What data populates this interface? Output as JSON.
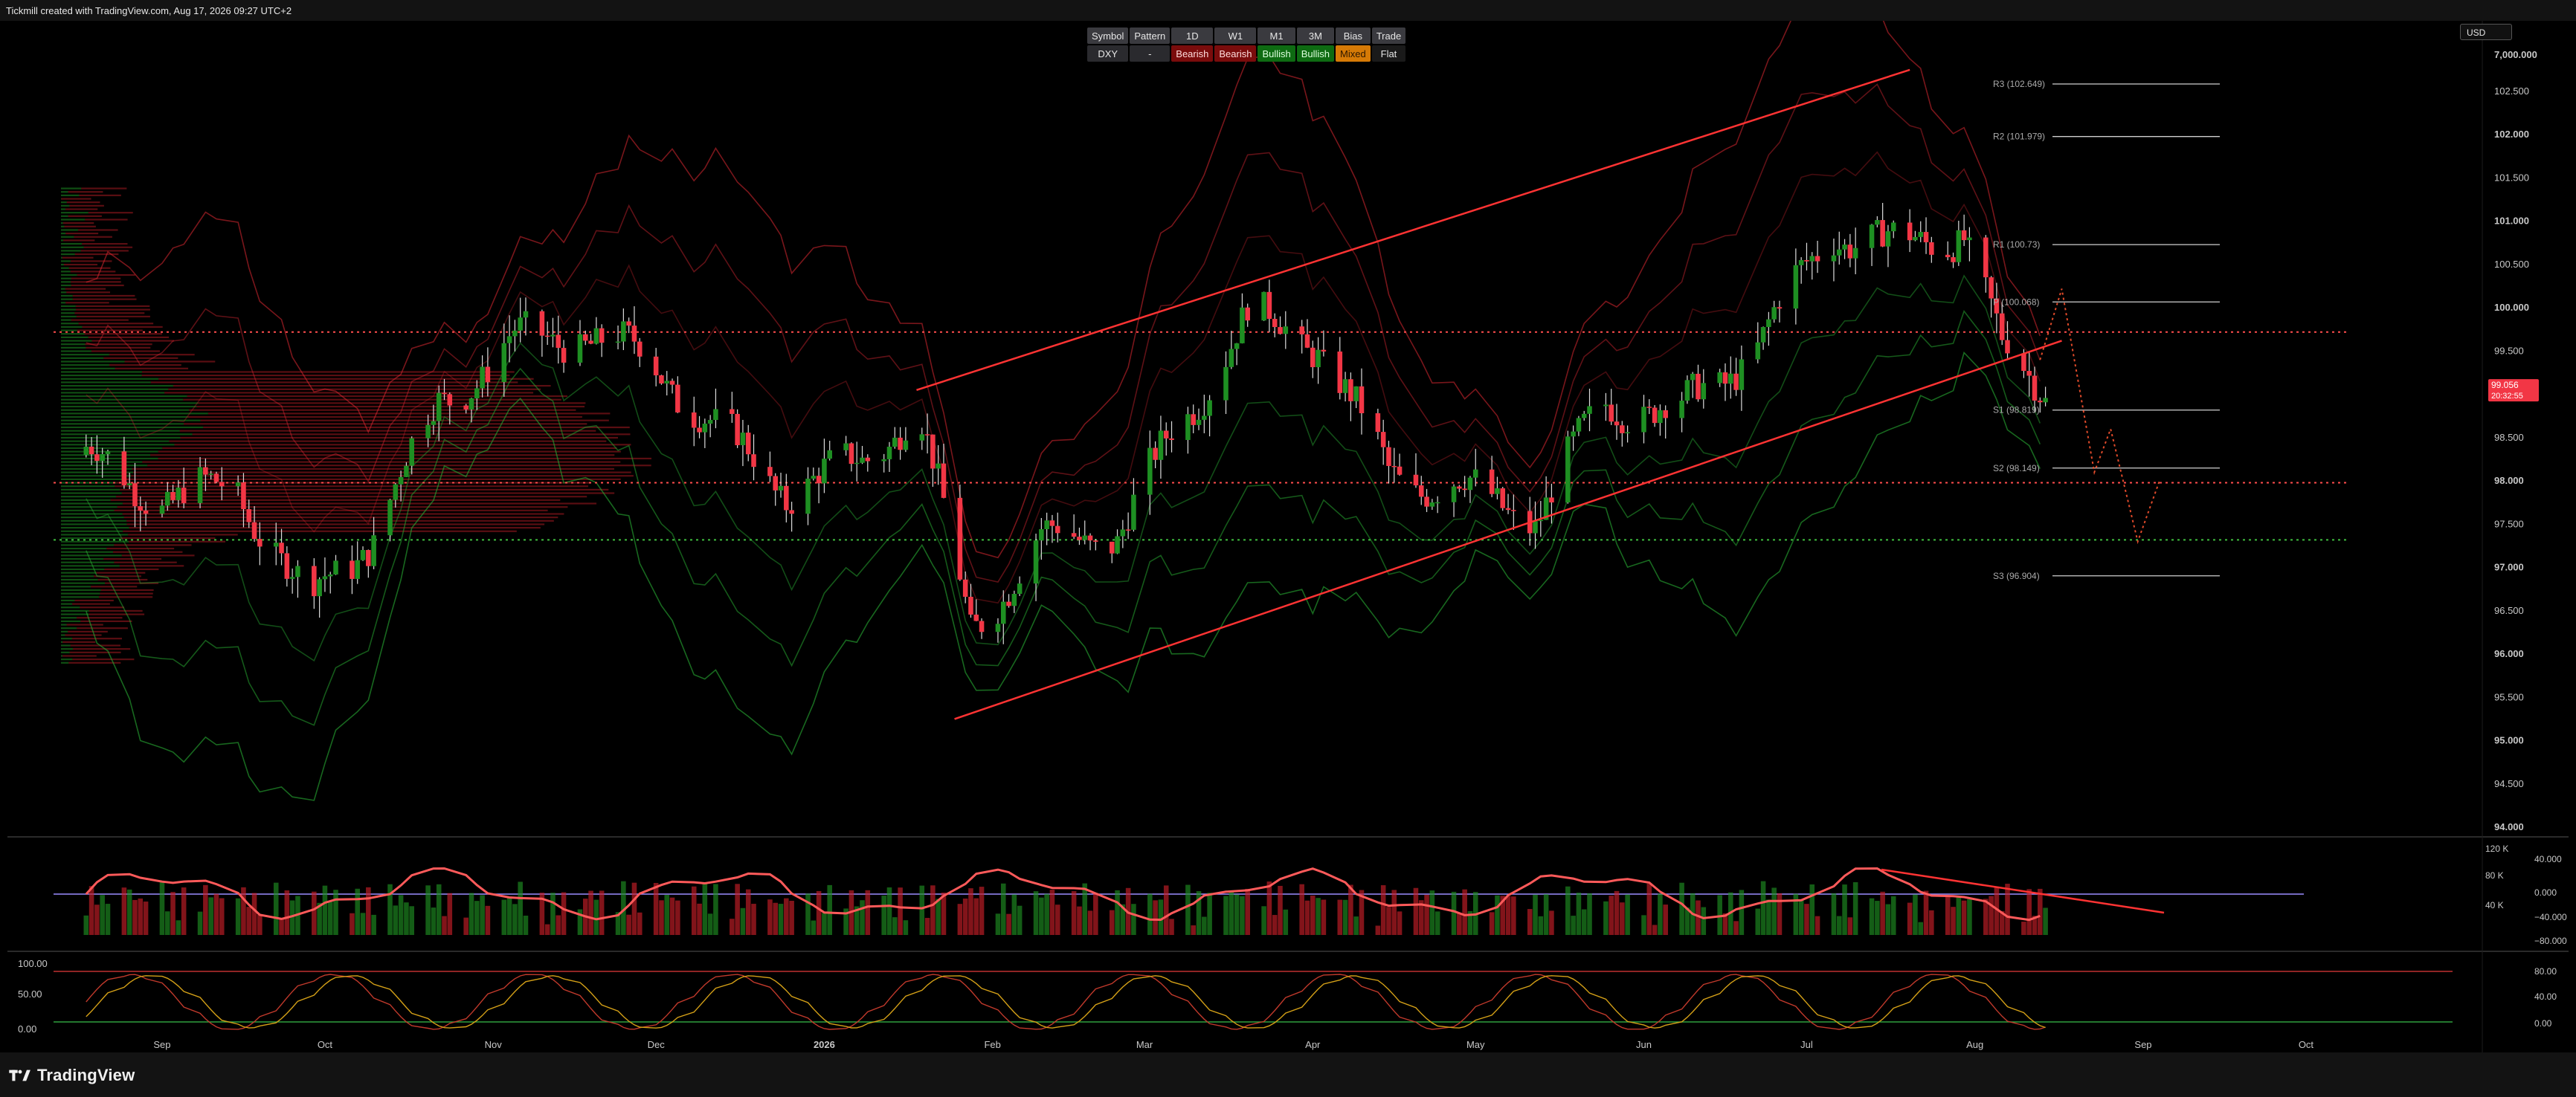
{
  "header": {
    "watermark": "Tickmill created with TradingView.com, Aug 17, 2026 09:27 UTC+2",
    "currency": "USD"
  },
  "bias_table": {
    "headers": [
      "Symbol",
      "Pattern",
      "1D",
      "W1",
      "M1",
      "3M",
      "Bias",
      "Trade"
    ],
    "values": [
      "DXY",
      "-",
      "Bearish",
      "Bearish",
      "Bullish",
      "Bullish",
      "Mixed",
      "Flat"
    ]
  },
  "footer": {
    "brand": "TradingView"
  },
  "chart_data": {
    "type": "candlestick",
    "symbol": "DXY",
    "x_ticks": [
      "Sep",
      "Oct",
      "Nov",
      "Dec",
      "2026",
      "Feb",
      "Mar",
      "Apr",
      "May",
      "Jun",
      "Jul",
      "Aug",
      "Sep",
      "Oct"
    ],
    "price_axis": {
      "ticks": [
        "7,000.000",
        "102.500",
        "102.000",
        "101.500",
        "101.000",
        "100.500",
        "100.000",
        "99.500",
        "99.000",
        "98.500",
        "98.000",
        "97.500",
        "97.000",
        "96.500",
        "96.000",
        "95.500",
        "95.000",
        "94.500",
        "94.000"
      ],
      "range": [
        94.0,
        102.5
      ]
    },
    "current_price": {
      "value": "99.056",
      "countdown": "20:32:55"
    },
    "pivots": [
      {
        "label": "R3 (102.649)",
        "value": 102.649
      },
      {
        "label": "R2 (101.979)",
        "value": 101.979
      },
      {
        "label": "R1 (100.73)",
        "value": 100.73
      },
      {
        "label": "P (100.068)",
        "value": 100.068
      },
      {
        "label": "S1 (98.819)",
        "value": 98.819
      },
      {
        "label": "S2 (98.149)",
        "value": 98.149
      },
      {
        "label": "S3 (96.904)",
        "value": 96.904
      }
    ],
    "horizontal_levels": [
      99.72,
      97.98,
      97.32
    ],
    "channel": {
      "upper": [
        {
          "x": "Jan 18",
          "y": 99.05
        },
        {
          "x": "Jul 20",
          "y": 102.75
        }
      ],
      "lower": [
        {
          "x": "Jan 25",
          "y": 95.25
        },
        {
          "x": "Aug 17",
          "y": 99.62
        }
      ]
    },
    "projection": [
      {
        "x": "Aug 13",
        "y": 99.4
      },
      {
        "x": "Aug 17",
        "y": 100.22
      },
      {
        "x": "Aug 23",
        "y": 98.1
      },
      {
        "x": "Aug 26",
        "y": 98.6
      },
      {
        "x": "Aug 31",
        "y": 97.3
      },
      {
        "x": "Sep 04",
        "y": 98.0
      }
    ],
    "monthly_closes": [
      {
        "x": "Aug 17",
        "y": 98.3
      },
      {
        "x": "Sep 01",
        "y": 97.8
      },
      {
        "x": "Sep 15",
        "y": 97.9
      },
      {
        "x": "Sep 28",
        "y": 96.6
      },
      {
        "x": "Oct 10",
        "y": 97.4
      },
      {
        "x": "Oct 22",
        "y": 98.9
      },
      {
        "x": "Nov 05",
        "y": 99.6
      },
      {
        "x": "Nov 18",
        "y": 99.7
      },
      {
        "x": "Nov 30",
        "y": 99.4
      },
      {
        "x": "Dec 12",
        "y": 98.6
      },
      {
        "x": "Dec 25",
        "y": 97.9
      },
      {
        "x": "Jan 08",
        "y": 98.2
      },
      {
        "x": "Jan 18",
        "y": 98.9
      },
      {
        "x": "Jan 28",
        "y": 96.3
      },
      {
        "x": "Feb 10",
        "y": 97.3
      },
      {
        "x": "Feb 24",
        "y": 97.4
      },
      {
        "x": "Mar 08",
        "y": 98.7
      },
      {
        "x": "Mar 20",
        "y": 99.9
      },
      {
        "x": "Apr 02",
        "y": 99.6
      },
      {
        "x": "Apr 15",
        "y": 98.1
      },
      {
        "x": "Apr 28",
        "y": 97.9
      },
      {
        "x": "May 12",
        "y": 97.6
      },
      {
        "x": "May 25",
        "y": 98.9
      },
      {
        "x": "Jun 08",
        "y": 98.8
      },
      {
        "x": "Jun 22",
        "y": 99.6
      },
      {
        "x": "Jul 06",
        "y": 100.9
      },
      {
        "x": "Jul 18",
        "y": 100.7
      },
      {
        "x": "Jul 30",
        "y": 100.9
      },
      {
        "x": "Aug 06",
        "y": 99.5
      },
      {
        "x": "Aug 14",
        "y": 99.06
      }
    ],
    "oscillator_panel": {
      "right_ticks": [
        "40.000",
        "0.000",
        "−40.000",
        "−80.000"
      ],
      "volume_ticks": [
        "120 K",
        "80 K",
        "40 K"
      ]
    },
    "stochastic_panel": {
      "left_ticks": [
        "100.00",
        "50.00",
        "0.00"
      ],
      "right_ticks": [
        "80.00",
        "40.00",
        "0.00"
      ]
    },
    "colors": {
      "bullish": "#1e8f22",
      "bearish": "#f23645",
      "channel": "#ff3333",
      "midline": "#9b8cff"
    }
  }
}
